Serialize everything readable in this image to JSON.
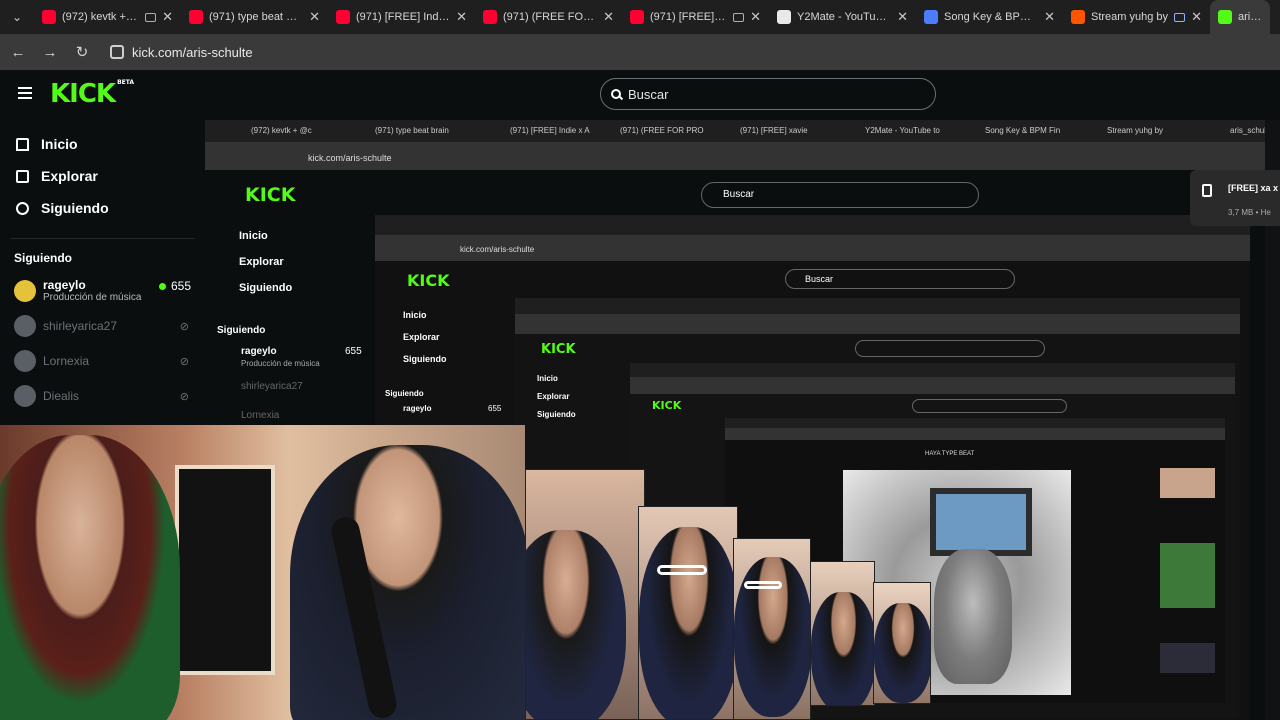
{
  "browser": {
    "tabs": [
      {
        "title": "(972) kevtk + @cr",
        "icon": "youtube-icon",
        "audio": true
      },
      {
        "title": "(971) type beat brain",
        "icon": "youtube-icon",
        "audio": false
      },
      {
        "title": "(971) [FREE] Indie x A",
        "icon": "youtube-icon",
        "audio": false
      },
      {
        "title": "(971) (FREE FOR PRO",
        "icon": "youtube-icon",
        "audio": false
      },
      {
        "title": "(971) [FREE] xavie",
        "icon": "youtube-icon",
        "audio": true
      },
      {
        "title": "Y2Mate - YouTube to",
        "icon": "y2mate-icon",
        "audio": false
      },
      {
        "title": "Song Key & BPM Fin",
        "icon": "songkey-icon",
        "audio": false
      },
      {
        "title": "Stream yuhg by",
        "icon": "soundcloud-icon",
        "audio": true
      },
      {
        "title": "aris_schul",
        "icon": "kick-icon",
        "audio": false
      }
    ],
    "url": "kick.com/aris-schulte"
  },
  "header": {
    "logo": "KICK",
    "logo_badge": "BETA",
    "search_placeholder": "Buscar"
  },
  "sidebar": {
    "nav": [
      {
        "label": "Inicio",
        "icon": "home-icon"
      },
      {
        "label": "Explorar",
        "icon": "compass-icon"
      },
      {
        "label": "Siguiendo",
        "icon": "heart-icon"
      }
    ],
    "following_heading": "Siguiendo",
    "channels": [
      {
        "name": "rageylo",
        "category": "Producción de música",
        "viewers": "655",
        "live": true
      },
      {
        "name": "shirleyarica27",
        "live": false
      },
      {
        "name": "Lornexia",
        "live": false
      },
      {
        "name": "Diealis",
        "live": false
      }
    ]
  },
  "stream": {
    "download_popup": {
      "title": "[FREE] xa x sample",
      "meta": "3,7 MB • He"
    },
    "nested": {
      "tab_1": "(972) kevtk + @c",
      "tab_2": "(971) type beat brain",
      "tab_3": "(971) [FREE] Indie x A",
      "tab_4": "(971) (FREE FOR PRO",
      "tab_5": "(971) [FREE] xavie",
      "tab_6": "Y2Mate - YouTube to",
      "tab_7": "Song Key & BPM Fin",
      "tab_8": "Stream yuhg by",
      "tab_9": "aris_schul",
      "url": "kick.com/aris-schulte",
      "search": "Buscar",
      "nav_1": "Inicio",
      "nav_2": "Explorar",
      "nav_3": "Siguiendo",
      "following": "Siguiendo",
      "channel_1": "rageylo",
      "channel_1_cat": "Producción de música",
      "channel_1_viewers": "655",
      "channel_2": "shirleyarica27",
      "channel_3": "Lornexia",
      "yt_search": "HAYA TYPE BEAT"
    }
  }
}
